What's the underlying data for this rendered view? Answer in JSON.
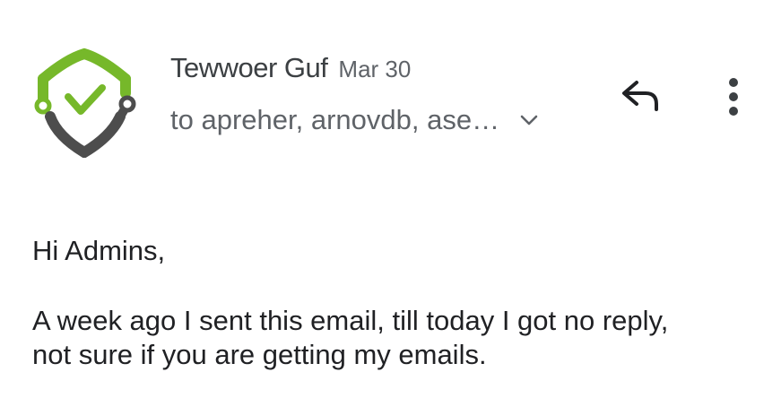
{
  "header": {
    "sender_name": "Tewwoer Guf",
    "date": "Mar 30",
    "recipients": "to apreher, arnovdb, ase…",
    "avatar_icon": "shield-check-icon",
    "reply_icon": "reply-icon",
    "more_icon": "more-vert-icon",
    "expand_icon": "chevron-down-icon"
  },
  "message": {
    "greeting": "Hi Admins,",
    "line_1": "A week ago I sent this email, till today I got no reply,",
    "line_2": "not sure if you are getting my emails."
  },
  "colors": {
    "shield_green": "#76b82a",
    "shield_gray": "#4d4d4d",
    "text_primary": "#202124",
    "text_secondary": "#5f6368"
  }
}
